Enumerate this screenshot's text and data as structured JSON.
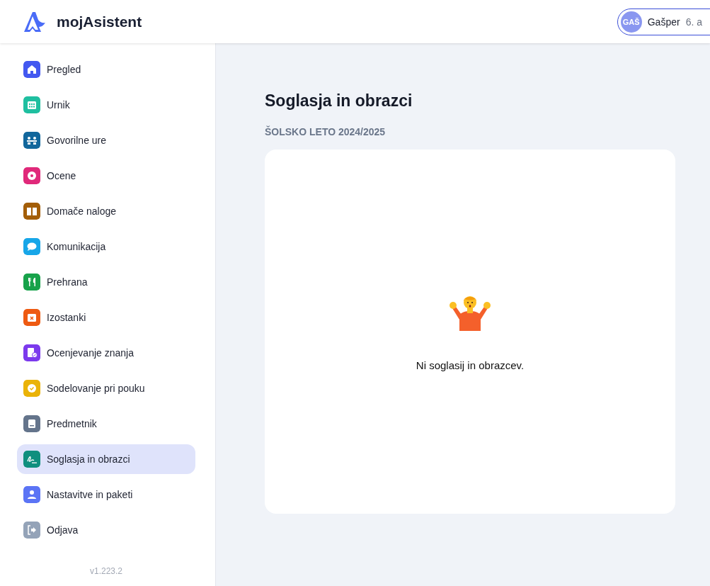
{
  "header": {
    "logo_text": "mojAsistent",
    "user": {
      "initials": "GAŠ",
      "name": "Gašper",
      "class": "6. a"
    }
  },
  "sidebar": {
    "items": [
      {
        "label": "Pregled",
        "color": "#4358f0",
        "selected": false
      },
      {
        "label": "Urnik",
        "color": "#1fbfa0",
        "selected": false
      },
      {
        "label": "Govorilne ure",
        "color": "#12679c",
        "selected": false
      },
      {
        "label": "Ocene",
        "color": "#e0297a",
        "selected": false
      },
      {
        "label": "Domače naloge",
        "color": "#a35e08",
        "selected": false
      },
      {
        "label": "Komunikacija",
        "color": "#17a6e8",
        "selected": false
      },
      {
        "label": "Prehrana",
        "color": "#17a24a",
        "selected": false
      },
      {
        "label": "Izostanki",
        "color": "#ee5a12",
        "selected": false
      },
      {
        "label": "Ocenjevanje znanja",
        "color": "#7c3aed",
        "selected": false
      },
      {
        "label": "Sodelovanje pri pouku",
        "color": "#eab308",
        "selected": false
      },
      {
        "label": "Predmetnik",
        "color": "#64748b",
        "selected": false
      },
      {
        "label": "Soglasja in obrazci",
        "color": "#0f8f7e",
        "selected": true
      },
      {
        "label": "Nastavitve in paketi",
        "color": "#5b74f5",
        "selected": false
      },
      {
        "label": "Odjava",
        "color": "#94a3b8",
        "selected": false
      }
    ],
    "version": "v1.223.2"
  },
  "main": {
    "title": "Soglasja in obrazci",
    "subtitle": "ŠOLSKO LETO 2024/2025",
    "empty_message": "Ni soglasij in obrazcev."
  }
}
